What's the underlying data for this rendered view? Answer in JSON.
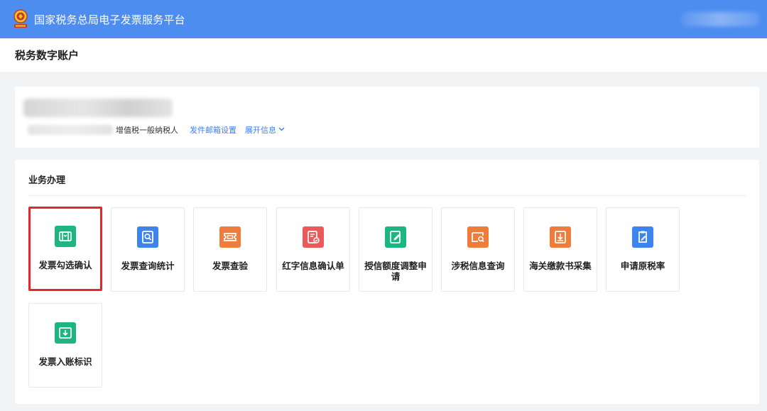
{
  "header": {
    "title": "国家税务总局电子发票服务平台",
    "logo_icon": "tax-emblem-icon",
    "bg_color": "#4d8df0"
  },
  "subheader": {
    "page_title": "税务数字账户"
  },
  "info_card": {
    "tax_type": "增值税一般纳税人",
    "email_setting_link": "发件邮箱设置",
    "expand_link": "展开信息",
    "expand_icon": "chevron-down-icon"
  },
  "business": {
    "section_title": "业务办理",
    "tiles": [
      {
        "label": "发票勾选确认",
        "icon": "invoice-select-icon",
        "color": "#1cb681",
        "selected": true
      },
      {
        "label": "发票查询统计",
        "icon": "invoice-search-icon",
        "color": "#3c84ee"
      },
      {
        "label": "发票查验",
        "icon": "ticket-check-icon",
        "color": "#f07c3c"
      },
      {
        "label": "红字信息确认单",
        "icon": "red-document-check-icon",
        "color": "#eb5a5a"
      },
      {
        "label": "授信额度调整申请",
        "icon": "edit-document-icon",
        "color": "#1cb681"
      },
      {
        "label": "涉税信息查询",
        "icon": "card-search-icon",
        "color": "#f07c3c"
      },
      {
        "label": "海关缴款书采集",
        "icon": "customs-collect-icon",
        "color": "#f07c3c"
      },
      {
        "label": "申请原税率",
        "icon": "clipboard-edit-icon",
        "color": "#3c84ee"
      },
      {
        "label": "发票入账标识",
        "icon": "invoice-ledger-icon",
        "color": "#1cb681"
      }
    ]
  },
  "colors": {
    "accent": "#3b7ff0",
    "selected_border": "#e5262b",
    "page_bg": "#f2f3f5"
  }
}
